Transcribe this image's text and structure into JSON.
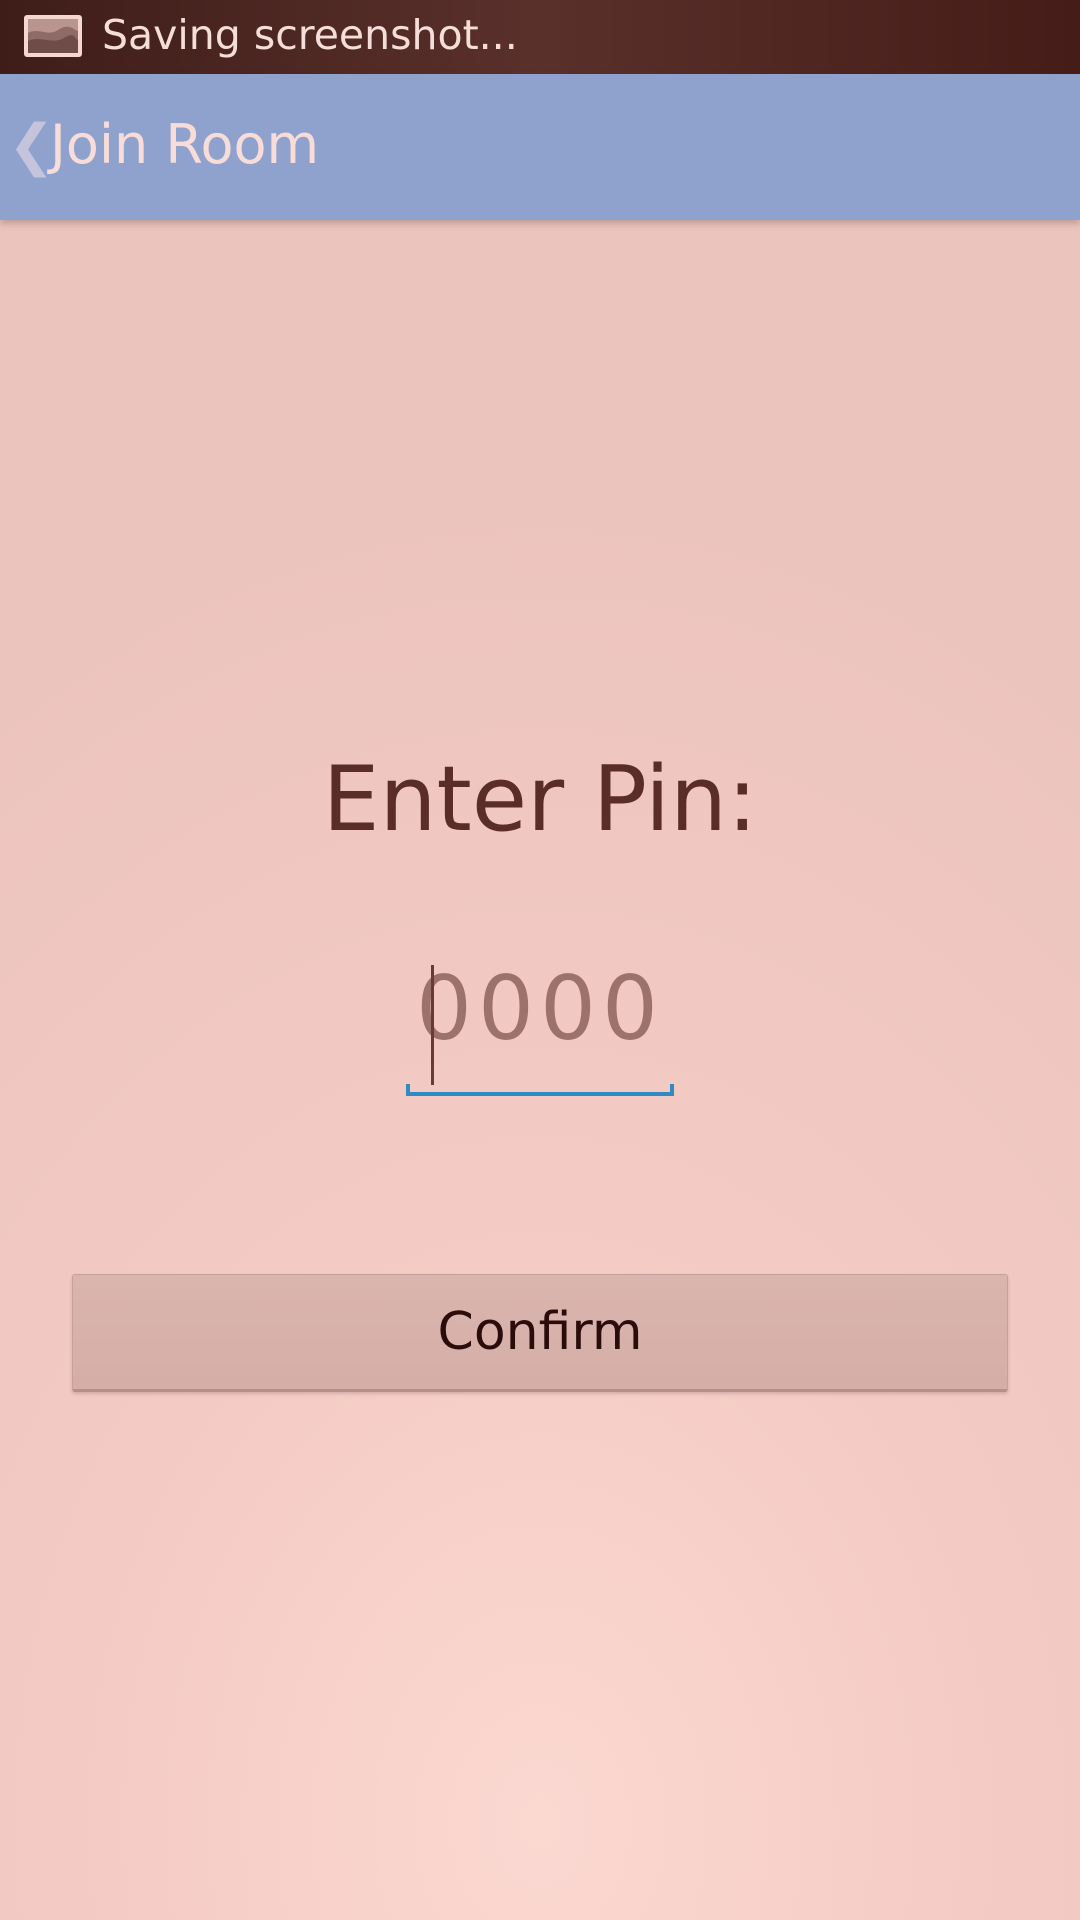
{
  "status_bar": {
    "notification_icon": "screenshot-icon",
    "text": "Saving screenshot..."
  },
  "action_bar": {
    "back_icon": "chevron-left-icon",
    "title": "Join Room",
    "accent_color": "#8fa1cd"
  },
  "main": {
    "prompt": "Enter Pin:",
    "pin_input": {
      "value": "",
      "placeholder": "0000",
      "focused": true,
      "focus_color": "#2f8cc2"
    },
    "confirm_label": "Confirm"
  }
}
